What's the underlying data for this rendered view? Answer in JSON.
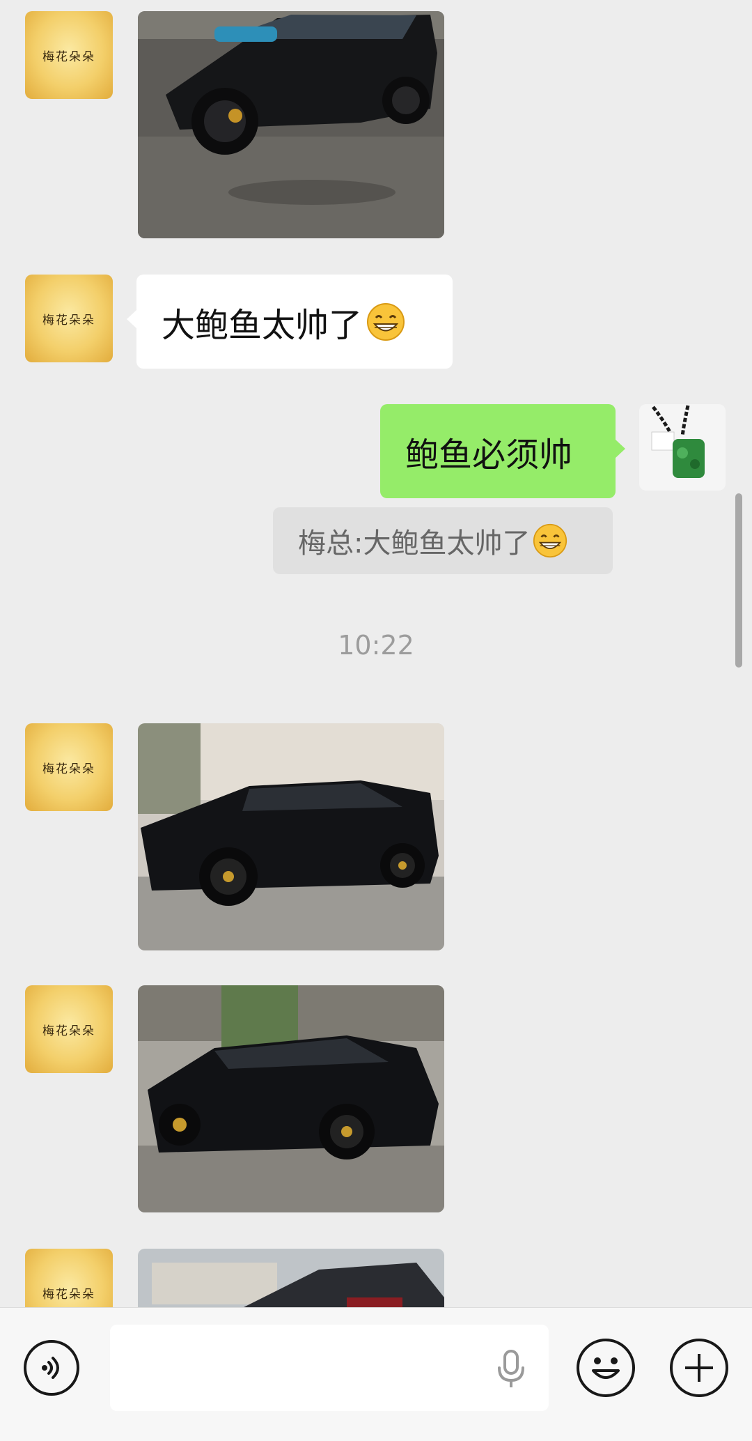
{
  "contact": {
    "avatar_text": "梅花朵朵"
  },
  "messages": {
    "incoming_text": "大鲍鱼太帅了",
    "outgoing_text": "鲍鱼必须帅",
    "quote_text": "梅总:大鲍鱼太帅了"
  },
  "timestamp": "10:22",
  "icons": {
    "emoji_in_message": "grin-emoji",
    "voice": "voice-icon",
    "mic": "mic-icon",
    "emoji_button": "smile-icon",
    "more_button": "plus-icon"
  },
  "colors": {
    "background": "#ededed",
    "incoming_bubble": "#ffffff",
    "outgoing_bubble": "#95ec69",
    "quote_bubble": "#e0e0e0",
    "input_bar": "#f7f7f7"
  }
}
